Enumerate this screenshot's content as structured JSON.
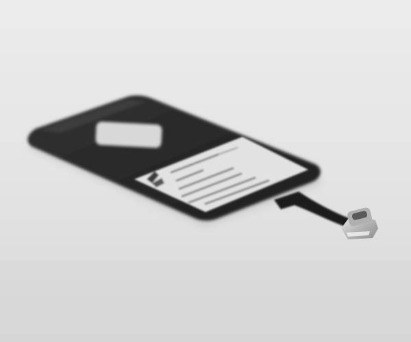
{
  "image": {
    "kind": "photograph",
    "style": "grayscale product photo",
    "subject": "wireless-charging-receiver-pad",
    "connector": "usb-type-c",
    "colors": {
      "background_light": "#f0f0f0",
      "background_dark": "#d9d9d9",
      "pad_body": "#2b2b2b",
      "pad_edge": "#3a3a3a",
      "label": "#dedede",
      "label_text": "#5a5a5a",
      "connector_metal": "#c8c8c8"
    }
  }
}
